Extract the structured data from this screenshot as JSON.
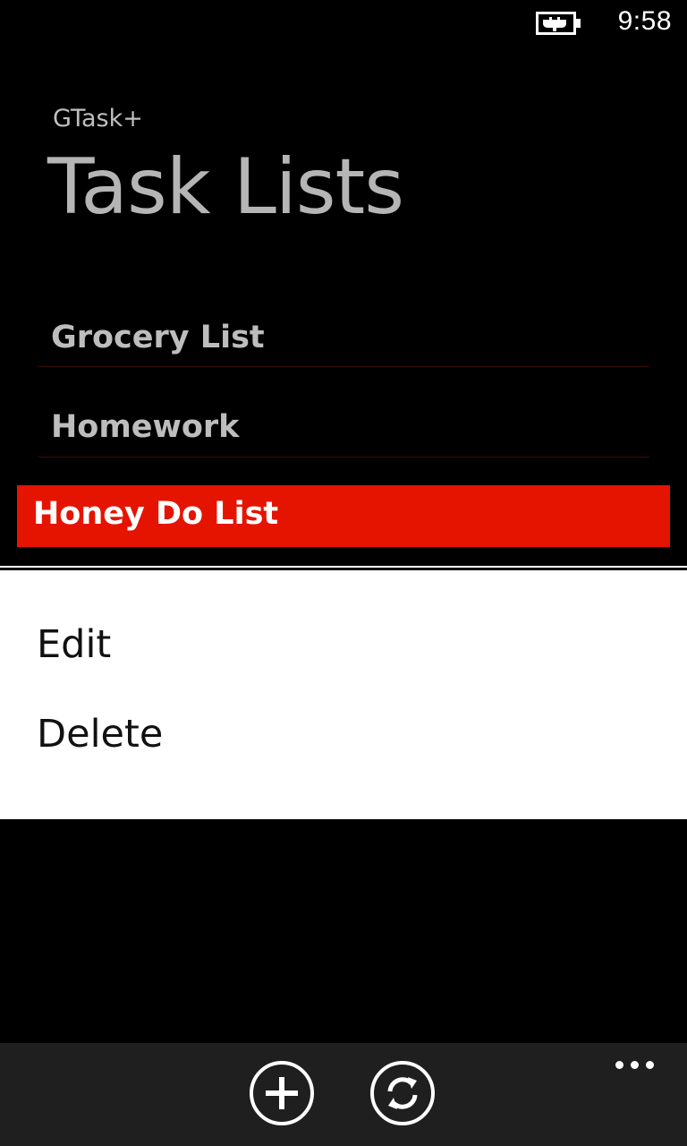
{
  "status_bar": {
    "battery_icon": "battery-charging-icon",
    "time": "9:58"
  },
  "header": {
    "app_name": "GTask+",
    "title": "Task Lists"
  },
  "task_lists": [
    {
      "label": "Grocery List",
      "selected": false
    },
    {
      "label": "Homework",
      "selected": false
    },
    {
      "label": "Honey Do List",
      "selected": true
    }
  ],
  "context_menu": {
    "items": [
      {
        "label": "Edit"
      },
      {
        "label": "Delete"
      }
    ]
  },
  "app_bar": {
    "buttons": [
      {
        "icon": "add-icon"
      },
      {
        "icon": "sync-icon"
      }
    ],
    "more_icon": "more-dots-icon"
  },
  "colors": {
    "accent": "#e51400",
    "background": "#000000",
    "menu_background": "#ffffff",
    "app_bar_background": "#1f1f1f"
  }
}
